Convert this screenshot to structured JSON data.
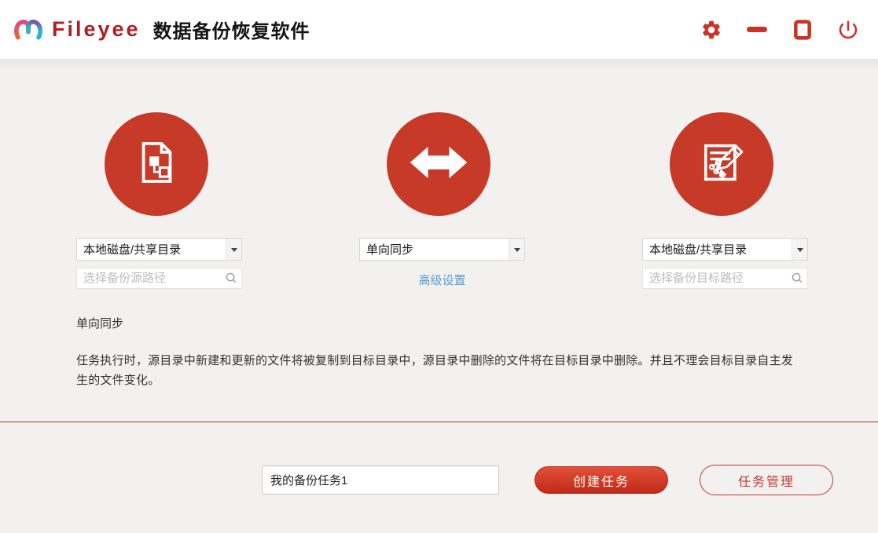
{
  "window": {
    "brand": "Fileyee",
    "app_title": "数据备份恢复软件"
  },
  "titlebar_icons": [
    "gear-icon",
    "minimize-icon",
    "maximize-icon",
    "power-icon"
  ],
  "source_panel": {
    "circle_icon": "document-tree-icon",
    "type_selected": "本地磁盘/共享目录",
    "path_placeholder": "选择备份源路径",
    "search_icon": "magnifier-icon"
  },
  "mode_panel": {
    "circle_icon": "double-arrow-icon",
    "mode_selected": "单向同步",
    "advanced_settings_label": "高级设置"
  },
  "target_panel": {
    "circle_icon": "edit-document-icon",
    "type_selected": "本地磁盘/共享目录",
    "path_placeholder": "选择备份目标路径",
    "search_icon": "magnifier-icon"
  },
  "description": {
    "title": "单向同步",
    "body": "任务执行时，源目录中新建和更新的文件将被复制到目标目录中，源目录中删除的文件将在目标目录中删除。并且不理会目标目录自主发生的文件变化。"
  },
  "footer": {
    "task_name_value": "我的备份任务1",
    "create_task_label": "创建任务",
    "task_manager_label": "任务管理"
  },
  "colors": {
    "accent_red": "#c73a28",
    "control_red": "#cc3226",
    "brand_red": "#b01f24",
    "link_blue": "#5b9bd5",
    "divider_red": "#a53a24",
    "main_bg": "#f2f1ef"
  }
}
